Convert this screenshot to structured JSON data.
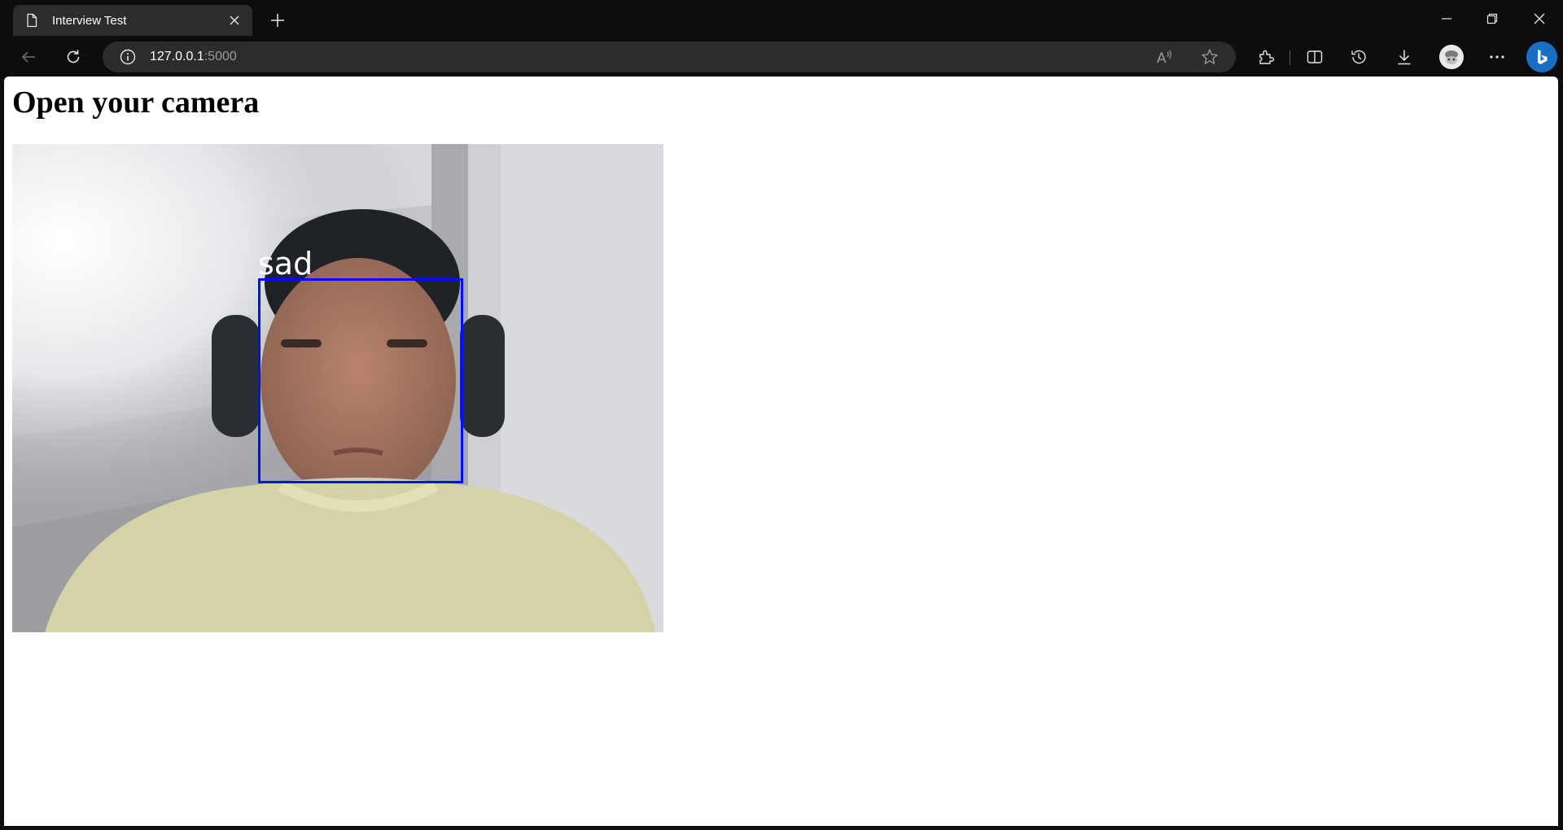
{
  "browser": {
    "tab_title": "Interview Test",
    "url_host": "127.0.0.1",
    "url_port": ":5000",
    "icons": {
      "tab": "document-icon",
      "close": "close-icon",
      "new_tab": "plus-icon",
      "back": "back-arrow-icon",
      "reload": "reload-icon",
      "info": "info-icon",
      "read_aloud": "read-aloud-icon",
      "favorite": "star-icon",
      "extensions": "puzzle-icon",
      "split": "split-screen-icon",
      "history": "history-icon",
      "downloads": "download-icon",
      "more": "more-icon",
      "copilot": "bing-icon"
    }
  },
  "page": {
    "heading": "Open your camera",
    "video": {
      "detection_label": "sad",
      "box_color": "#0010ff"
    }
  },
  "colors": {
    "chrome_bg": "#0d0d0d",
    "tab_bg": "#2c2c2c",
    "page_bg": "#ffffff"
  }
}
